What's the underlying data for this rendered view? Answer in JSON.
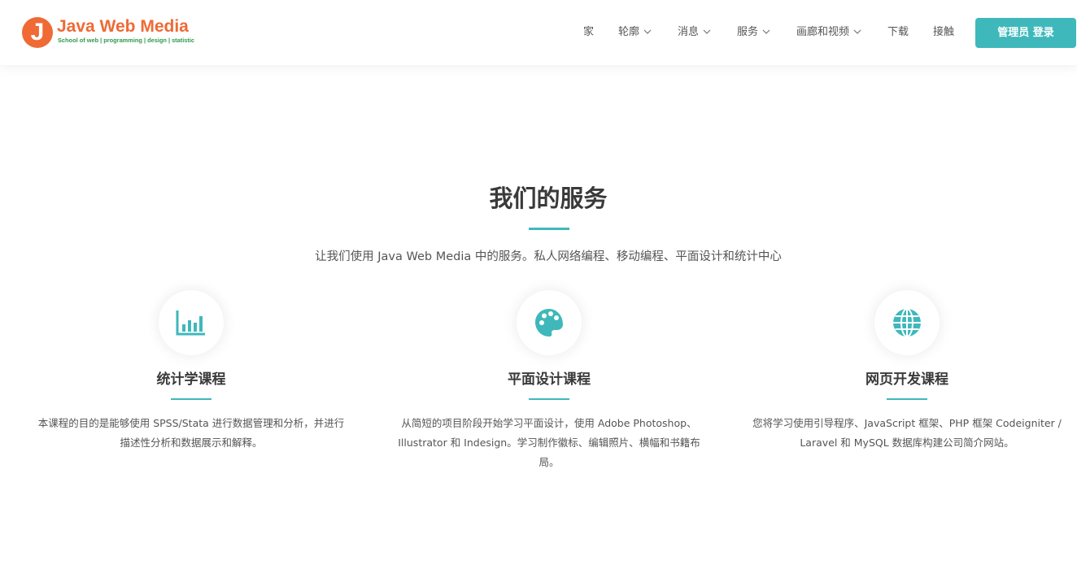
{
  "brand": {
    "mark": "J",
    "name": "Java Web Media",
    "tagline": "School of web | programming | design | statistic",
    "accent_color": "#3fb8bb",
    "logo_color": "#ef6a35"
  },
  "nav": {
    "items": [
      {
        "label": "家",
        "has_dropdown": false
      },
      {
        "label": "轮廓",
        "has_dropdown": true
      },
      {
        "label": "消息",
        "has_dropdown": true
      },
      {
        "label": "服务",
        "has_dropdown": true
      },
      {
        "label": "画廊和视频",
        "has_dropdown": true
      },
      {
        "label": "下载",
        "has_dropdown": false
      },
      {
        "label": "接触",
        "has_dropdown": false
      }
    ],
    "login_label": "管理员 登录"
  },
  "services_section": {
    "title": "我们的服务",
    "subtitle": "让我们使用 Java Web Media 中的服务。私人网络编程、移动编程、平面设计和统计中心",
    "items": [
      {
        "icon": "bar-chart-icon",
        "title": "统计学课程",
        "desc_lines": [
          "本课程的目的是能够使用 SPSS/Stata 进行数据管理和分析，并进行",
          "描述性分析和数据展示和解释。"
        ]
      },
      {
        "icon": "palette-icon",
        "title": "平面设计课程",
        "desc_lines": [
          "从简短的项目阶段开始学习平面设计，使用 Adobe Photoshop、",
          "Illustrator 和 Indesign。学习制作徽标、编辑照片、横幅和书籍布",
          "局。"
        ]
      },
      {
        "icon": "globe-icon",
        "title": "网页开发课程",
        "desc_lines": [
          "您将学习使用引导程序、JavaScript 框架、PHP 框架 Codeigniter /",
          "Laravel 和 MySQL 数据库构建公司简介网站。"
        ]
      }
    ]
  }
}
